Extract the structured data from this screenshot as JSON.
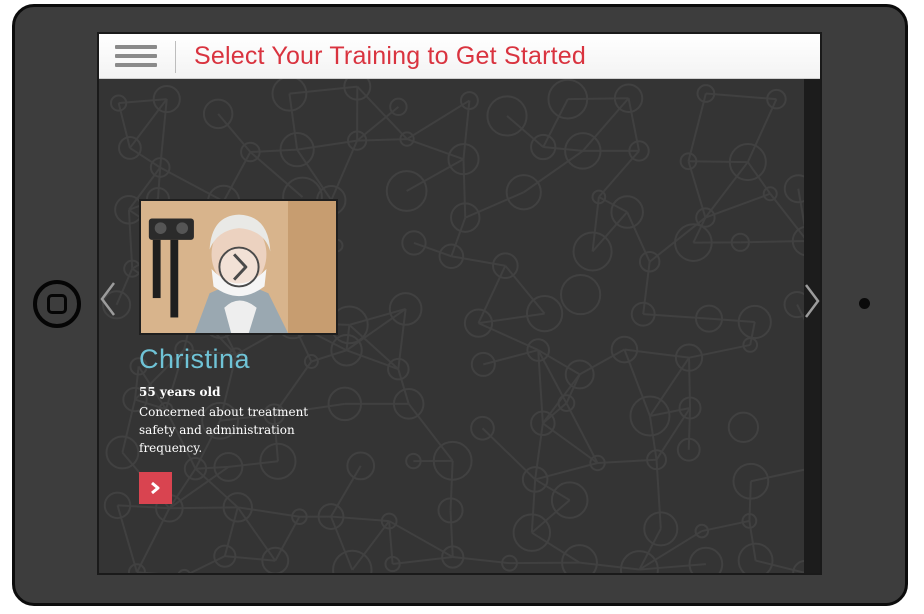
{
  "header": {
    "title": "Select Your Training to Get Started"
  },
  "card": {
    "name": "Christina",
    "age": "55 years old",
    "description": "Concerned about treatment safety and administration frequency."
  },
  "icons": {
    "menu": "hamburger-menu-icon",
    "play": "play-chevron-icon",
    "go": "chevron-right-icon",
    "prev": "chevron-left-icon",
    "next": "chevron-right-icon"
  },
  "colors": {
    "title": "#d9333f",
    "name": "#6fc3d6",
    "go_button": "#d94450",
    "screen_bg": "#343434",
    "device_bezel": "#3d3d3d"
  }
}
